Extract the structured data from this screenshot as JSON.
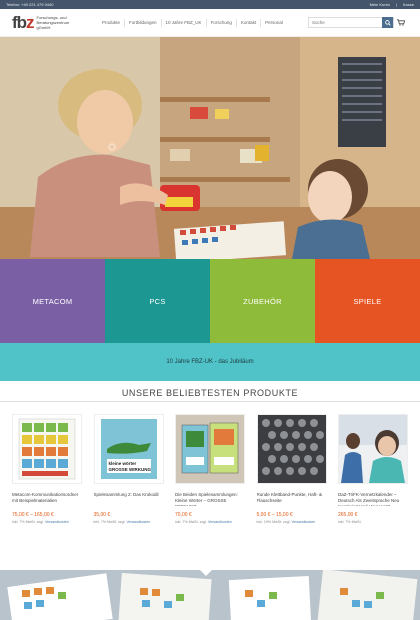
{
  "topbar": {
    "phone": "Telefon: +49 221 479 0440",
    "account": "Mein Konto",
    "checkout": "Kasse"
  },
  "logo": {
    "mark": "fbz",
    "line1": "Forschungs- und",
    "line2": "Beratungszentrum",
    "line3": "gGmbH"
  },
  "nav": [
    "Produkte",
    "Fortbildungen",
    "10 Jahre FBZ_UK",
    "Forschung",
    "Kontakt",
    "Personal"
  ],
  "search": {
    "placeholder": "Suche"
  },
  "tiles": [
    {
      "label": "METACOM",
      "color": "#7a5fa5"
    },
    {
      "label": "PCS",
      "color": "#1d9791"
    },
    {
      "label": "ZUBEHÖR",
      "color": "#8fbb3a"
    },
    {
      "label": "SPIELE",
      "color": "#e75424"
    }
  ],
  "jubilee": {
    "label": "10 Jahre FBZ-UK - das Jubiläum"
  },
  "section": {
    "title": "UNSERE BELIEBTESTEN PRODUKTE"
  },
  "products": [
    {
      "name": "Metacom-Kommunikationsordner mit Beispielmaterialien",
      "price": "75,00 € – 165,00 €",
      "vat": "inkl. 7% MwSt. zzgl.",
      "shipping": "Versandkosten"
    },
    {
      "name": "Spielesammlung 2: Das Krokodil",
      "price": "35,00 €",
      "vat": "inkl. 7% MwSt. zzgl.",
      "shipping": "Versandkosten"
    },
    {
      "name": "Die Beiden Spielesammlungen: Kleine Wörter – GROSSE WIRKUNG",
      "price": "70,00 €",
      "vat": "inkl. 7% MwSt. zzgl.",
      "shipping": "Versandkosten"
    },
    {
      "name": "Runde Klettband-Punkte, Haft- & Flauschseite",
      "price": "5,00 € – 15,00 €",
      "vat": "inkl. 19% MwSt. zzgl.",
      "shipping": "Versandkosten"
    },
    {
      "name": "DaZ-TriFK-Vernetzkalender – Deutsch Als Zweitsprache Neu Konzipiert Und Umgesetzt – Zweitägige Fortbildung",
      "price": "265,00 €",
      "vat": "inkl. 7% MwSt.",
      "shipping": ""
    }
  ],
  "thumb_text": {
    "book2_line1": "kleine wörter",
    "book2_line2": "GROSSE WIRKUNG"
  },
  "colors": {
    "accent": "#e05a12",
    "topbar": "#44556b",
    "link": "#4b7aa8"
  }
}
